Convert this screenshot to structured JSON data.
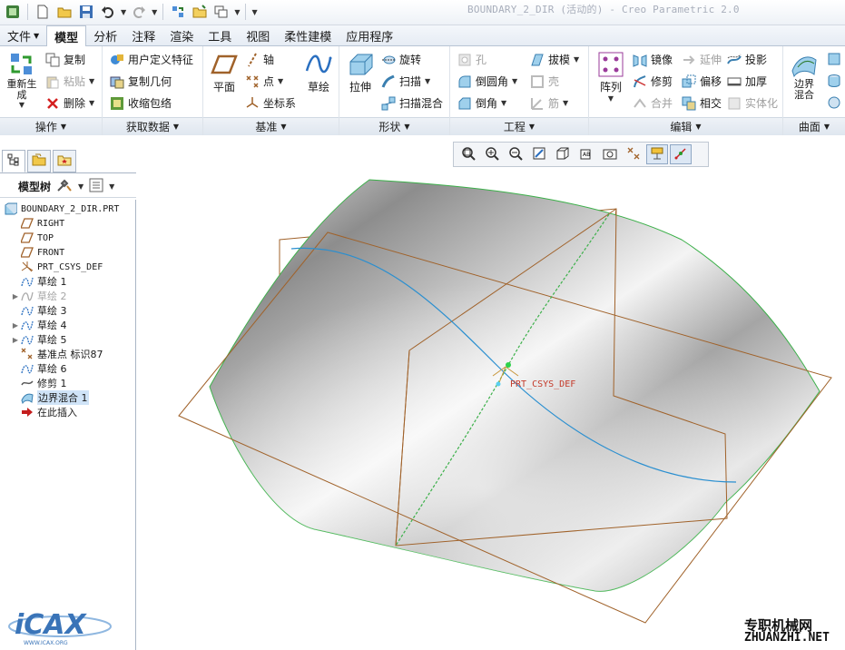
{
  "window": {
    "title": "BOUNDARY_2_DIR (活动的) - Creo Parametric 2.0"
  },
  "tabs": [
    {
      "label": "文件",
      "has_menu": true
    },
    {
      "label": "模型",
      "active": true
    },
    {
      "label": "分析"
    },
    {
      "label": "注释"
    },
    {
      "label": "渲染"
    },
    {
      "label": "工具"
    },
    {
      "label": "视图"
    },
    {
      "label": "柔性建模"
    },
    {
      "label": "应用程序"
    }
  ],
  "ribbon": {
    "operations": {
      "label": "操作",
      "regenerate": "重新生\n成",
      "copy": "复制",
      "paste": "粘贴",
      "delete": "删除"
    },
    "get_data": {
      "label": "获取数据",
      "udf": "用户定义特征",
      "copy_geom": "复制几何",
      "shrinkwrap": "收缩包络"
    },
    "datum": {
      "label": "基准",
      "plane": "平面",
      "axis": "轴",
      "point": "点",
      "csys": "坐标系",
      "sketch": "草绘"
    },
    "shapes": {
      "label": "形状",
      "extrude": "拉伸",
      "revolve": "旋转",
      "sweep": "扫描",
      "swept_blend": "扫描混合"
    },
    "engineering": {
      "label": "工程",
      "hole": "孔",
      "draft": "拔模",
      "round": "倒圆角",
      "shell": "壳",
      "chamfer": "倒角",
      "rib": "筋"
    },
    "editing": {
      "label": "编辑",
      "pattern": "阵列",
      "mirror": "镜像",
      "extend": "延伸",
      "project": "投影",
      "trim": "修剪",
      "offset": "偏移",
      "thicken": "加厚",
      "merge": "合并",
      "intersect": "相交",
      "solidify": "实体化"
    },
    "surfaces": {
      "label": "曲面",
      "boundary_blend": "边界\n混合"
    }
  },
  "model_tree": {
    "header": "模型树",
    "nodes": [
      {
        "label": "BOUNDARY_2_DIR.PRT",
        "icon": "part-icon",
        "mono": true
      },
      {
        "label": "RIGHT",
        "icon": "datum-plane-icon",
        "mono": true
      },
      {
        "label": "TOP",
        "icon": "datum-plane-icon",
        "mono": true
      },
      {
        "label": "FRONT",
        "icon": "datum-plane-icon",
        "mono": true
      },
      {
        "label": "PRT_CSYS_DEF",
        "icon": "csys-icon",
        "mono": true
      },
      {
        "label": "草绘 1",
        "icon": "sketch-icon"
      },
      {
        "label": "草绘 2",
        "icon": "sketch-icon",
        "expandable": true,
        "dim": true
      },
      {
        "label": "草绘 3",
        "icon": "sketch-icon"
      },
      {
        "label": "草绘 4",
        "icon": "sketch-icon",
        "expandable": true
      },
      {
        "label": "草绘 5",
        "icon": "sketch-icon",
        "expandable": true
      },
      {
        "label": "基准点 标识87",
        "icon": "datum-point-icon"
      },
      {
        "label": "草绘 6",
        "icon": "sketch-icon"
      },
      {
        "label": "修剪 1",
        "icon": "trim-curve-icon"
      },
      {
        "label": "边界混合 1",
        "icon": "boundary-blend-icon",
        "selected": true
      },
      {
        "label": "在此插入",
        "icon": "insert-arrow-icon"
      }
    ]
  },
  "viewport": {
    "csys_label": "PRT_CSYS_DEF"
  },
  "watermarks": {
    "left": "iCAX",
    "left_sub": "WWW.ICAX.ORG",
    "right_cn": "专职机械网",
    "right_en": "ZHUANZHI.NET"
  },
  "colors": {
    "datum_plane": "#a0622a",
    "boundary_curve": "#3cb04a",
    "inner_curve": "#2a8fd0",
    "surface_shade": "#b8b8b8",
    "selection": "#cfe3f7"
  }
}
